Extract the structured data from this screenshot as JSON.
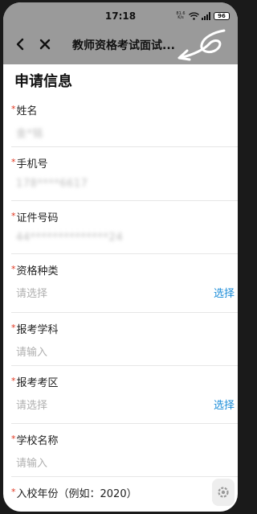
{
  "status_bar": {
    "time": "17:18",
    "net_speed_value": "81.6",
    "net_speed_unit": "K/s",
    "battery": "96"
  },
  "nav": {
    "title": "教师资格考试面试..."
  },
  "section_title": "申请信息",
  "required_mark": "*",
  "fields": {
    "name": {
      "label": "姓名",
      "value": "金*铭"
    },
    "phone": {
      "label": "手机号",
      "value": "178****6617"
    },
    "id_number": {
      "label": "证件号码",
      "value": "44**************24"
    },
    "qualification_type": {
      "label": "资格种类",
      "placeholder": "请选择",
      "action": "选择"
    },
    "subject": {
      "label": "报考学科",
      "placeholder": "请输入"
    },
    "exam_area": {
      "label": "报考考区",
      "placeholder": "请选择",
      "action": "选择"
    },
    "school_name": {
      "label": "学校名称",
      "placeholder": "请输入"
    },
    "enrollment_year": {
      "label": "入校年份（例如：2020）"
    }
  },
  "colors": {
    "header_bg": "#9a9a9a",
    "required": "#e0341e",
    "link": "#1a8cd8",
    "placeholder": "#b0b0b0"
  },
  "icons": [
    "back-arrow-icon",
    "close-icon",
    "wifi-icon",
    "signal-icon",
    "battery-icon",
    "settings-gear-icon"
  ]
}
